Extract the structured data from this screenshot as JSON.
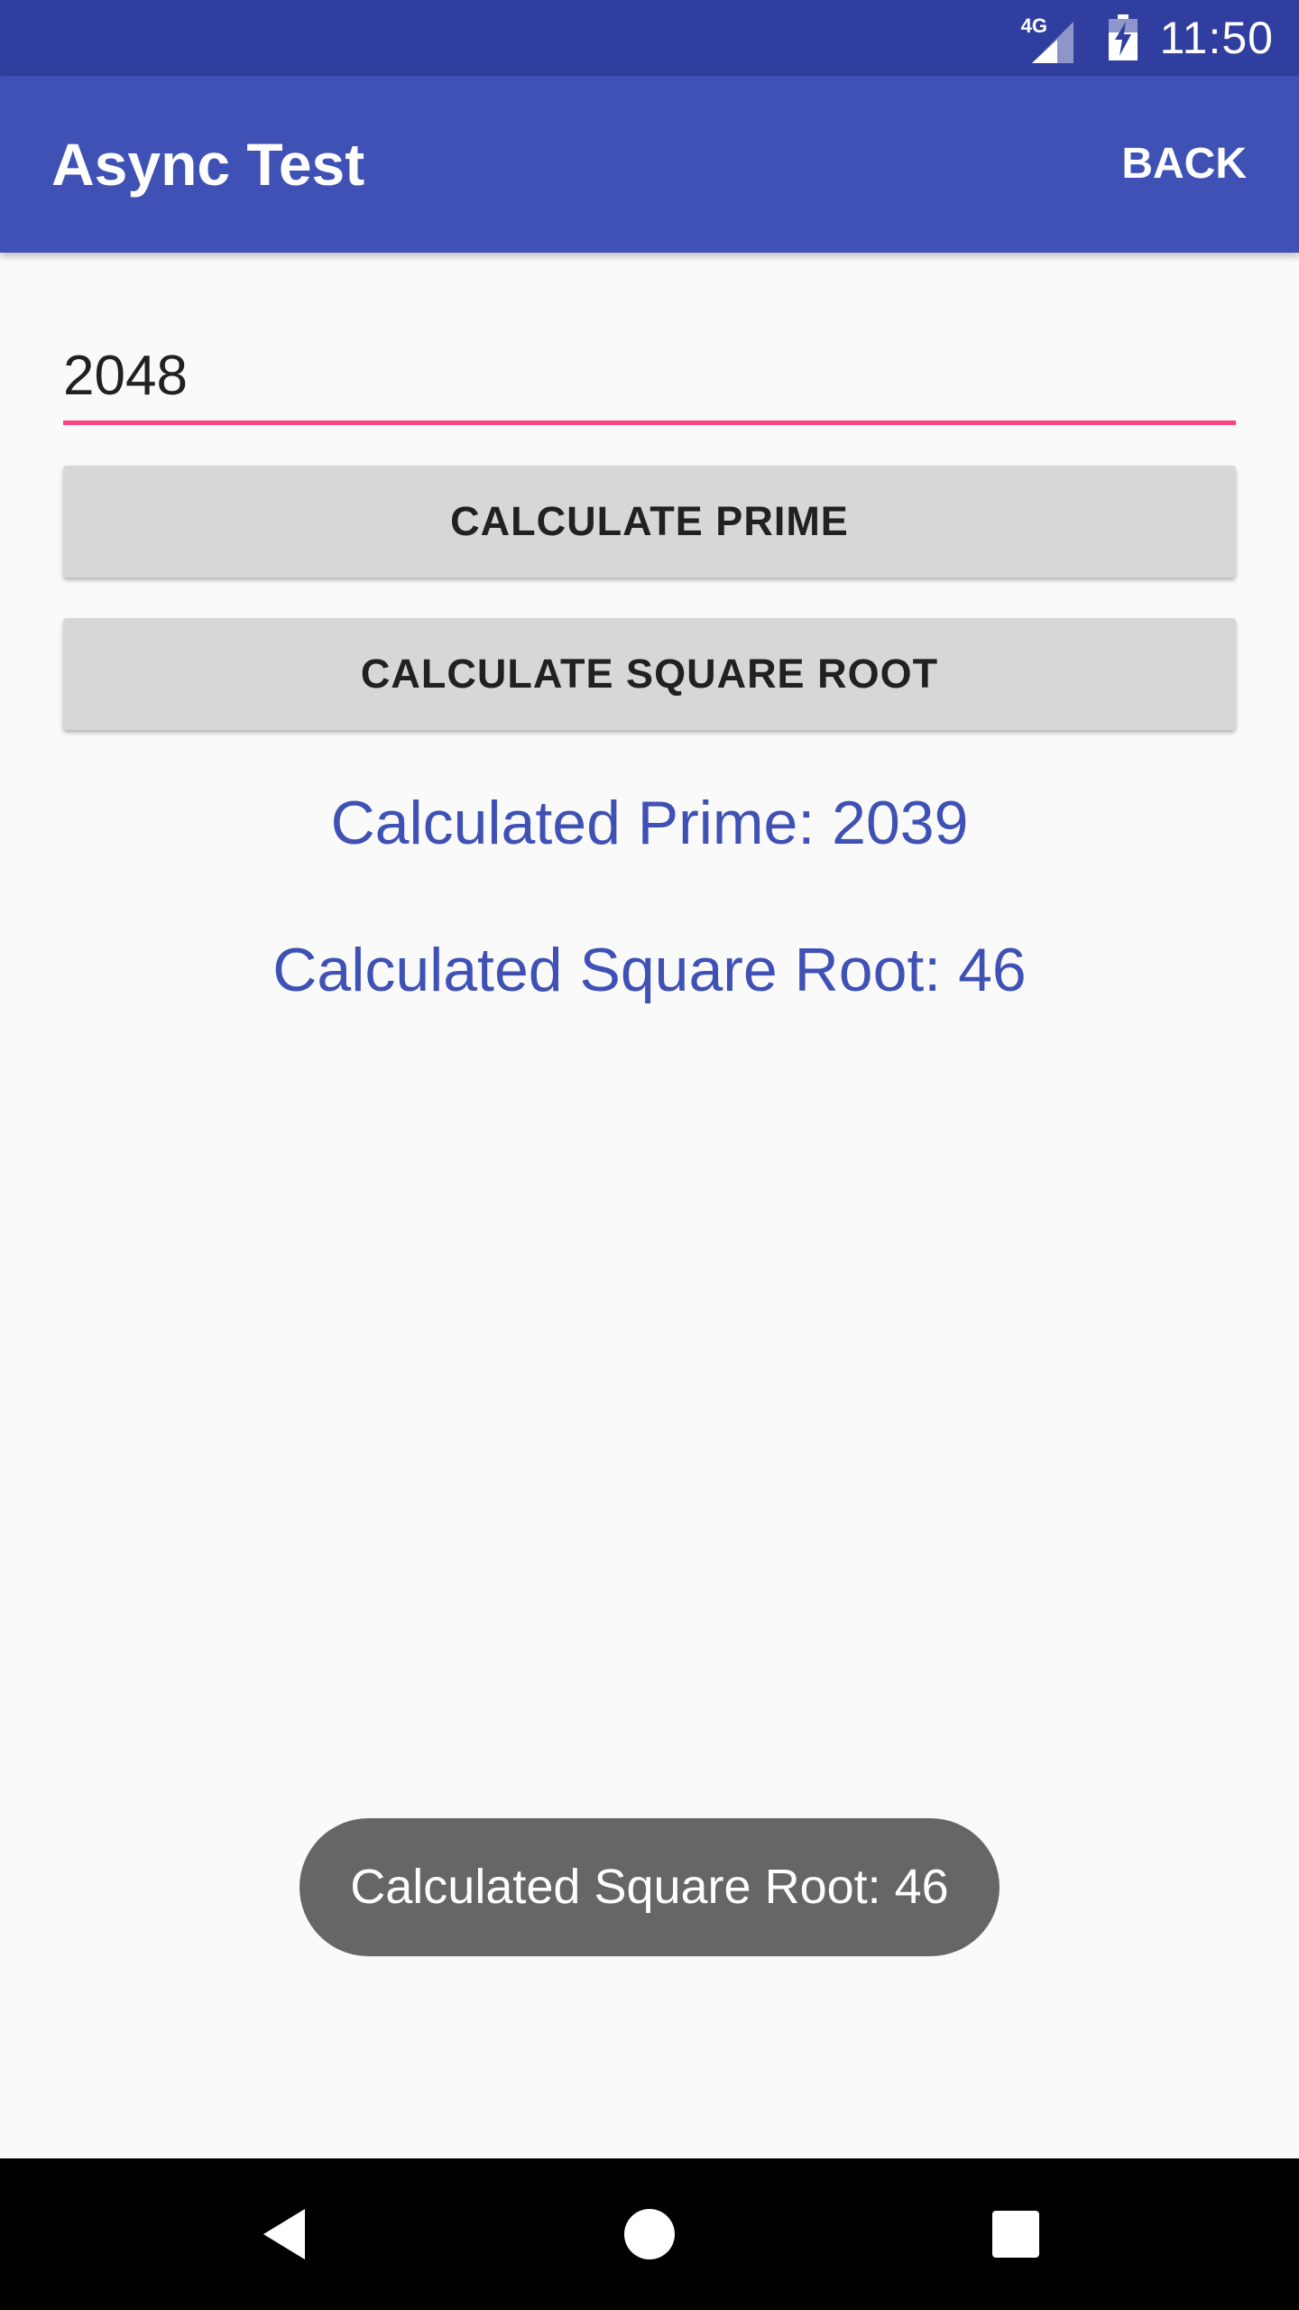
{
  "status_bar": {
    "network_type": "4G",
    "time": "11:50",
    "icons": [
      "signal-icon",
      "battery-charging-icon"
    ]
  },
  "app_bar": {
    "title": "Async Test",
    "back_label": "BACK"
  },
  "input": {
    "value": "2048",
    "accent_color": "#FF4081"
  },
  "buttons": {
    "calculate_prime": "CALCULATE PRIME",
    "calculate_square_root": "CALCULATE SQUARE ROOT"
  },
  "results": {
    "prime": "Calculated Prime: 2039",
    "square_root": "Calculated Square Root: 46"
  },
  "toast": {
    "message": "Calculated Square Root: 46"
  },
  "nav_bar": {
    "icons": [
      "back-triangle-icon",
      "home-circle-icon",
      "recents-square-icon"
    ]
  },
  "colors": {
    "primary": "#3F51B5",
    "primary_dark": "#303F9F",
    "accent": "#FF4081",
    "button_bg": "#D6D7D7",
    "toast_bg": "#666666"
  }
}
